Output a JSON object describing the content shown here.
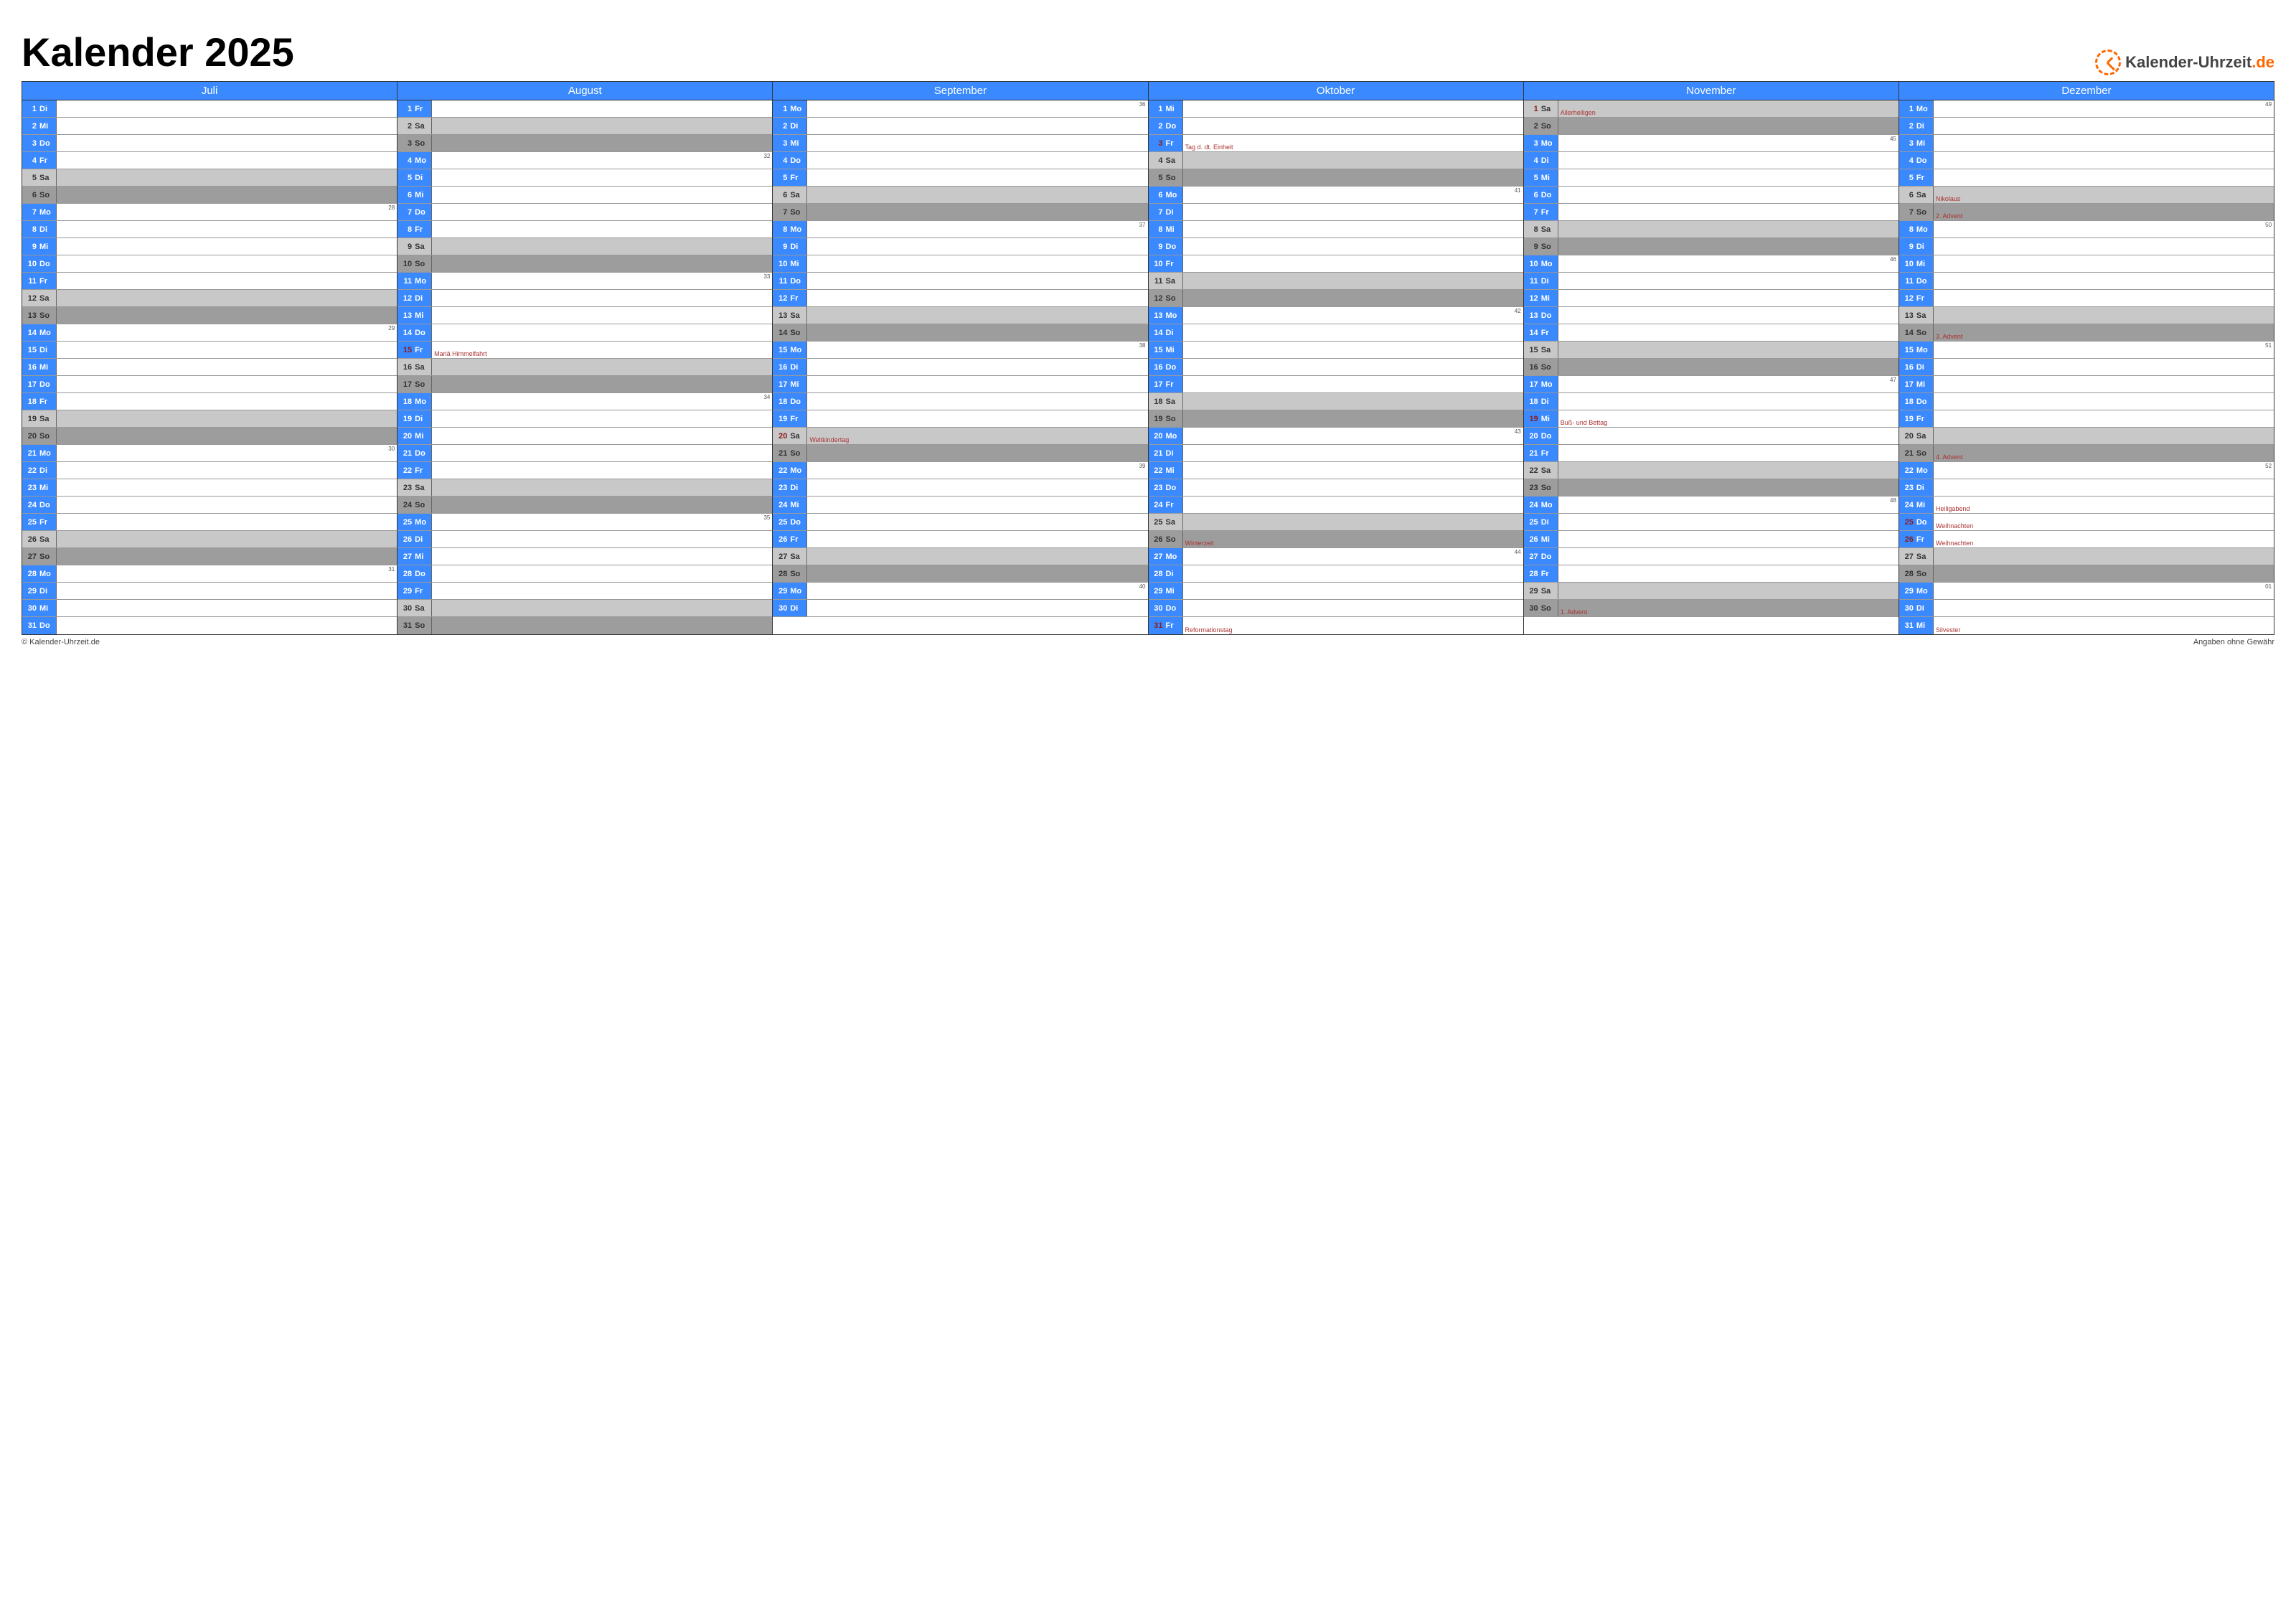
{
  "title": "Kalender 2025",
  "logo_text": "Kalender-Uhrzeit",
  "logo_suffix": ".de",
  "footer_left": "© Kalender-Uhrzeit.de",
  "footer_right": "Angaben ohne Gewähr",
  "months": [
    {
      "name": "Juli",
      "days": [
        {
          "n": 1,
          "w": "Di"
        },
        {
          "n": 2,
          "w": "Mi"
        },
        {
          "n": 3,
          "w": "Do"
        },
        {
          "n": 4,
          "w": "Fr"
        },
        {
          "n": 5,
          "w": "Sa",
          "t": "sat"
        },
        {
          "n": 6,
          "w": "So",
          "t": "sun"
        },
        {
          "n": 7,
          "w": "Mo",
          "wk": 28
        },
        {
          "n": 8,
          "w": "Di"
        },
        {
          "n": 9,
          "w": "Mi"
        },
        {
          "n": 10,
          "w": "Do"
        },
        {
          "n": 11,
          "w": "Fr"
        },
        {
          "n": 12,
          "w": "Sa",
          "t": "sat"
        },
        {
          "n": 13,
          "w": "So",
          "t": "sun"
        },
        {
          "n": 14,
          "w": "Mo",
          "wk": 29
        },
        {
          "n": 15,
          "w": "Di"
        },
        {
          "n": 16,
          "w": "Mi"
        },
        {
          "n": 17,
          "w": "Do"
        },
        {
          "n": 18,
          "w": "Fr"
        },
        {
          "n": 19,
          "w": "Sa",
          "t": "sat"
        },
        {
          "n": 20,
          "w": "So",
          "t": "sun"
        },
        {
          "n": 21,
          "w": "Mo",
          "wk": 30
        },
        {
          "n": 22,
          "w": "Di"
        },
        {
          "n": 23,
          "w": "Mi"
        },
        {
          "n": 24,
          "w": "Do"
        },
        {
          "n": 25,
          "w": "Fr"
        },
        {
          "n": 26,
          "w": "Sa",
          "t": "sat"
        },
        {
          "n": 27,
          "w": "So",
          "t": "sun"
        },
        {
          "n": 28,
          "w": "Mo",
          "wk": 31
        },
        {
          "n": 29,
          "w": "Di"
        },
        {
          "n": 30,
          "w": "Mi"
        },
        {
          "n": 31,
          "w": "Do"
        }
      ]
    },
    {
      "name": "August",
      "days": [
        {
          "n": 1,
          "w": "Fr"
        },
        {
          "n": 2,
          "w": "Sa",
          "t": "sat"
        },
        {
          "n": 3,
          "w": "So",
          "t": "sun"
        },
        {
          "n": 4,
          "w": "Mo",
          "wk": 32
        },
        {
          "n": 5,
          "w": "Di"
        },
        {
          "n": 6,
          "w": "Mi"
        },
        {
          "n": 7,
          "w": "Do"
        },
        {
          "n": 8,
          "w": "Fr"
        },
        {
          "n": 9,
          "w": "Sa",
          "t": "sat"
        },
        {
          "n": 10,
          "w": "So",
          "t": "sun"
        },
        {
          "n": 11,
          "w": "Mo",
          "wk": 33
        },
        {
          "n": 12,
          "w": "Di"
        },
        {
          "n": 13,
          "w": "Mi"
        },
        {
          "n": 14,
          "w": "Do"
        },
        {
          "n": 15,
          "w": "Fr",
          "h": 1,
          "note": "Mariä Himmelfahrt"
        },
        {
          "n": 16,
          "w": "Sa",
          "t": "sat"
        },
        {
          "n": 17,
          "w": "So",
          "t": "sun"
        },
        {
          "n": 18,
          "w": "Mo",
          "wk": 34
        },
        {
          "n": 19,
          "w": "Di"
        },
        {
          "n": 20,
          "w": "Mi"
        },
        {
          "n": 21,
          "w": "Do"
        },
        {
          "n": 22,
          "w": "Fr"
        },
        {
          "n": 23,
          "w": "Sa",
          "t": "sat"
        },
        {
          "n": 24,
          "w": "So",
          "t": "sun"
        },
        {
          "n": 25,
          "w": "Mo",
          "wk": 35
        },
        {
          "n": 26,
          "w": "Di"
        },
        {
          "n": 27,
          "w": "Mi"
        },
        {
          "n": 28,
          "w": "Do"
        },
        {
          "n": 29,
          "w": "Fr"
        },
        {
          "n": 30,
          "w": "Sa",
          "t": "sat"
        },
        {
          "n": 31,
          "w": "So",
          "t": "sun"
        }
      ]
    },
    {
      "name": "September",
      "days": [
        {
          "n": 1,
          "w": "Mo",
          "wk": 36
        },
        {
          "n": 2,
          "w": "Di"
        },
        {
          "n": 3,
          "w": "Mi"
        },
        {
          "n": 4,
          "w": "Do"
        },
        {
          "n": 5,
          "w": "Fr"
        },
        {
          "n": 6,
          "w": "Sa",
          "t": "sat"
        },
        {
          "n": 7,
          "w": "So",
          "t": "sun"
        },
        {
          "n": 8,
          "w": "Mo",
          "wk": 37
        },
        {
          "n": 9,
          "w": "Di"
        },
        {
          "n": 10,
          "w": "Mi"
        },
        {
          "n": 11,
          "w": "Do"
        },
        {
          "n": 12,
          "w": "Fr"
        },
        {
          "n": 13,
          "w": "Sa",
          "t": "sat"
        },
        {
          "n": 14,
          "w": "So",
          "t": "sun"
        },
        {
          "n": 15,
          "w": "Mo",
          "wk": 38
        },
        {
          "n": 16,
          "w": "Di"
        },
        {
          "n": 17,
          "w": "Mi"
        },
        {
          "n": 18,
          "w": "Do"
        },
        {
          "n": 19,
          "w": "Fr"
        },
        {
          "n": 20,
          "w": "Sa",
          "t": "sat",
          "h": 1,
          "note": "Weltkindertag"
        },
        {
          "n": 21,
          "w": "So",
          "t": "sun"
        },
        {
          "n": 22,
          "w": "Mo",
          "wk": 39
        },
        {
          "n": 23,
          "w": "Di"
        },
        {
          "n": 24,
          "w": "Mi"
        },
        {
          "n": 25,
          "w": "Do"
        },
        {
          "n": 26,
          "w": "Fr"
        },
        {
          "n": 27,
          "w": "Sa",
          "t": "sat"
        },
        {
          "n": 28,
          "w": "So",
          "t": "sun"
        },
        {
          "n": 29,
          "w": "Mo",
          "wk": 40
        },
        {
          "n": 30,
          "w": "Di"
        }
      ]
    },
    {
      "name": "Oktober",
      "days": [
        {
          "n": 1,
          "w": "Mi"
        },
        {
          "n": 2,
          "w": "Do"
        },
        {
          "n": 3,
          "w": "Fr",
          "h": 1,
          "note": "Tag d. dt. Einheit"
        },
        {
          "n": 4,
          "w": "Sa",
          "t": "sat"
        },
        {
          "n": 5,
          "w": "So",
          "t": "sun"
        },
        {
          "n": 6,
          "w": "Mo",
          "wk": 41
        },
        {
          "n": 7,
          "w": "Di"
        },
        {
          "n": 8,
          "w": "Mi"
        },
        {
          "n": 9,
          "w": "Do"
        },
        {
          "n": 10,
          "w": "Fr"
        },
        {
          "n": 11,
          "w": "Sa",
          "t": "sat"
        },
        {
          "n": 12,
          "w": "So",
          "t": "sun"
        },
        {
          "n": 13,
          "w": "Mo",
          "wk": 42
        },
        {
          "n": 14,
          "w": "Di"
        },
        {
          "n": 15,
          "w": "Mi"
        },
        {
          "n": 16,
          "w": "Do"
        },
        {
          "n": 17,
          "w": "Fr"
        },
        {
          "n": 18,
          "w": "Sa",
          "t": "sat"
        },
        {
          "n": 19,
          "w": "So",
          "t": "sun"
        },
        {
          "n": 20,
          "w": "Mo",
          "wk": 43
        },
        {
          "n": 21,
          "w": "Di"
        },
        {
          "n": 22,
          "w": "Mi"
        },
        {
          "n": 23,
          "w": "Do"
        },
        {
          "n": 24,
          "w": "Fr"
        },
        {
          "n": 25,
          "w": "Sa",
          "t": "sat"
        },
        {
          "n": 26,
          "w": "So",
          "t": "sun",
          "note": "Winterzeit"
        },
        {
          "n": 27,
          "w": "Mo",
          "wk": 44
        },
        {
          "n": 28,
          "w": "Di"
        },
        {
          "n": 29,
          "w": "Mi"
        },
        {
          "n": 30,
          "w": "Do"
        },
        {
          "n": 31,
          "w": "Fr",
          "h": 1,
          "note": "Reformationstag"
        }
      ]
    },
    {
      "name": "November",
      "days": [
        {
          "n": 1,
          "w": "Sa",
          "t": "sat",
          "h": 1,
          "note": "Allerheiligen"
        },
        {
          "n": 2,
          "w": "So",
          "t": "sun"
        },
        {
          "n": 3,
          "w": "Mo",
          "wk": 45
        },
        {
          "n": 4,
          "w": "Di"
        },
        {
          "n": 5,
          "w": "Mi"
        },
        {
          "n": 6,
          "w": "Do"
        },
        {
          "n": 7,
          "w": "Fr"
        },
        {
          "n": 8,
          "w": "Sa",
          "t": "sat"
        },
        {
          "n": 9,
          "w": "So",
          "t": "sun"
        },
        {
          "n": 10,
          "w": "Mo",
          "wk": 46
        },
        {
          "n": 11,
          "w": "Di"
        },
        {
          "n": 12,
          "w": "Mi"
        },
        {
          "n": 13,
          "w": "Do"
        },
        {
          "n": 14,
          "w": "Fr"
        },
        {
          "n": 15,
          "w": "Sa",
          "t": "sat"
        },
        {
          "n": 16,
          "w": "So",
          "t": "sun"
        },
        {
          "n": 17,
          "w": "Mo",
          "wk": 47
        },
        {
          "n": 18,
          "w": "Di"
        },
        {
          "n": 19,
          "w": "Mi",
          "h": 1,
          "note": "Buß- und Bettag"
        },
        {
          "n": 20,
          "w": "Do"
        },
        {
          "n": 21,
          "w": "Fr"
        },
        {
          "n": 22,
          "w": "Sa",
          "t": "sat"
        },
        {
          "n": 23,
          "w": "So",
          "t": "sun"
        },
        {
          "n": 24,
          "w": "Mo",
          "wk": 48
        },
        {
          "n": 25,
          "w": "Di"
        },
        {
          "n": 26,
          "w": "Mi"
        },
        {
          "n": 27,
          "w": "Do"
        },
        {
          "n": 28,
          "w": "Fr"
        },
        {
          "n": 29,
          "w": "Sa",
          "t": "sat"
        },
        {
          "n": 30,
          "w": "So",
          "t": "sun",
          "note": "1. Advent"
        }
      ]
    },
    {
      "name": "Dezember",
      "days": [
        {
          "n": 1,
          "w": "Mo",
          "wk": 49
        },
        {
          "n": 2,
          "w": "Di"
        },
        {
          "n": 3,
          "w": "Mi"
        },
        {
          "n": 4,
          "w": "Do"
        },
        {
          "n": 5,
          "w": "Fr"
        },
        {
          "n": 6,
          "w": "Sa",
          "t": "sat",
          "note": "Nikolaus"
        },
        {
          "n": 7,
          "w": "So",
          "t": "sun",
          "note": "2. Advent"
        },
        {
          "n": 8,
          "w": "Mo",
          "wk": 50
        },
        {
          "n": 9,
          "w": "Di"
        },
        {
          "n": 10,
          "w": "Mi"
        },
        {
          "n": 11,
          "w": "Do"
        },
        {
          "n": 12,
          "w": "Fr"
        },
        {
          "n": 13,
          "w": "Sa",
          "t": "sat"
        },
        {
          "n": 14,
          "w": "So",
          "t": "sun",
          "note": "3. Advent"
        },
        {
          "n": 15,
          "w": "Mo",
          "wk": 51
        },
        {
          "n": 16,
          "w": "Di"
        },
        {
          "n": 17,
          "w": "Mi"
        },
        {
          "n": 18,
          "w": "Do"
        },
        {
          "n": 19,
          "w": "Fr"
        },
        {
          "n": 20,
          "w": "Sa",
          "t": "sat"
        },
        {
          "n": 21,
          "w": "So",
          "t": "sun",
          "note": "4. Advent"
        },
        {
          "n": 22,
          "w": "Mo",
          "wk": 52
        },
        {
          "n": 23,
          "w": "Di"
        },
        {
          "n": 24,
          "w": "Mi",
          "note": "Heiligabend"
        },
        {
          "n": 25,
          "w": "Do",
          "h": 1,
          "note": "Weihnachten"
        },
        {
          "n": 26,
          "w": "Fr",
          "h": 1,
          "note": "Weihnachten"
        },
        {
          "n": 27,
          "w": "Sa",
          "t": "sat"
        },
        {
          "n": 28,
          "w": "So",
          "t": "sun"
        },
        {
          "n": 29,
          "w": "Mo",
          "wk": "01"
        },
        {
          "n": 30,
          "w": "Di"
        },
        {
          "n": 31,
          "w": "Mi",
          "note": "Silvester"
        }
      ]
    }
  ]
}
